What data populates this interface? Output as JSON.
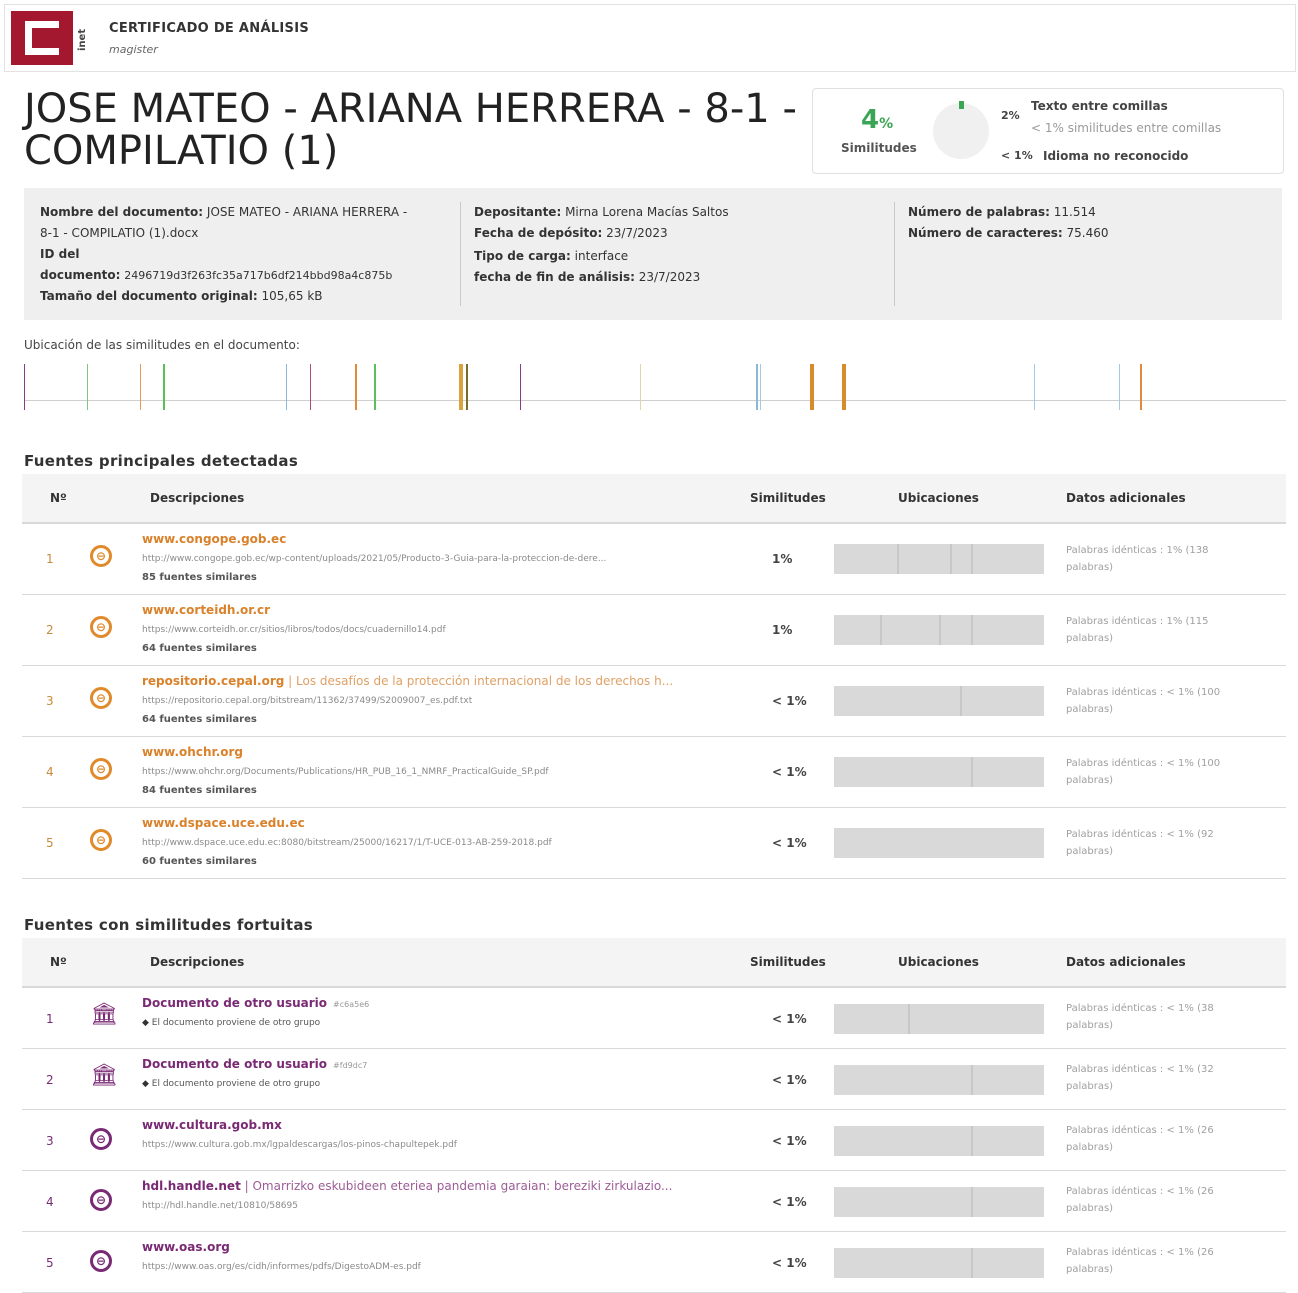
{
  "header": {
    "logo_side_text": "inet",
    "title": "CERTIFICADO DE ANÁLISIS",
    "subtitle": "magister"
  },
  "document_title": "JOSE MATEO - ARIANA HERRERA - 8-1 - COMPILATIO (1)",
  "summary": {
    "percent": "4",
    "percent_unit": "%",
    "label": "Similitudes",
    "lines": [
      {
        "value": "2%",
        "text": "Texto entre comillas"
      },
      {
        "value": "",
        "text": "< 1% similitudes entre comillas"
      },
      {
        "value": "< 1%",
        "text": "Idioma no reconocido"
      }
    ]
  },
  "info": {
    "col1": [
      {
        "label": "Nombre del documento:",
        "value": "JOSE MATEO - ARIANA HERRERA -"
      },
      {
        "label": "",
        "value": "8-1 - COMPILATIO (1).docx"
      },
      {
        "label": "ID del",
        "value": ""
      },
      {
        "label": "documento:",
        "value": "2496719d3f263fc35a717b6df214bbd98a4c875b"
      },
      {
        "label": "Tamaño del documento original:",
        "value": "105,65 kB"
      }
    ],
    "col2": [
      {
        "label": "Depositante:",
        "value": "Mirna Lorena Macías Saltos"
      },
      {
        "label": "Fecha de depósito:",
        "value": "23/7/2023"
      },
      {
        "label": "Tipo de carga:",
        "value": "interface"
      },
      {
        "label": "fecha de fin de análisis:",
        "value": "23/7/2023"
      }
    ],
    "col3": [
      {
        "label": "Número de palabras:",
        "value": "11.514"
      },
      {
        "label": "Número de caracteres:",
        "value": "75.460"
      }
    ]
  },
  "location_label": "Ubicación de las similitudes en el documento:",
  "location_ticks": [
    {
      "pos": 0.0,
      "color": "#8b3a8b",
      "w": 1
    },
    {
      "pos": 0.05,
      "color": "#7fc47f",
      "w": 1
    },
    {
      "pos": 0.092,
      "color": "#e39a5a",
      "w": 1
    },
    {
      "pos": 0.11,
      "color": "#5cbf5c",
      "w": 2
    },
    {
      "pos": 0.208,
      "color": "#8bb8d8",
      "w": 1
    },
    {
      "pos": 0.227,
      "color": "#b24a7a",
      "w": 1
    },
    {
      "pos": 0.262,
      "color": "#e08a3c",
      "w": 2
    },
    {
      "pos": 0.277,
      "color": "#5cbf5c",
      "w": 2
    },
    {
      "pos": 0.345,
      "color": "#d9a43c",
      "w": 4
    },
    {
      "pos": 0.35,
      "color": "#7b6a2a",
      "w": 2
    },
    {
      "pos": 0.393,
      "color": "#8b3a8b",
      "w": 1
    },
    {
      "pos": 0.488,
      "color": "#e5d2a8",
      "w": 1
    },
    {
      "pos": 0.58,
      "color": "#8bb8d8",
      "w": 2
    },
    {
      "pos": 0.583,
      "color": "#a8c8e0",
      "w": 1
    },
    {
      "pos": 0.623,
      "color": "#d98a2c",
      "w": 4
    },
    {
      "pos": 0.648,
      "color": "#d98a2c",
      "w": 4
    },
    {
      "pos": 0.8,
      "color": "#a8c8e0",
      "w": 1
    },
    {
      "pos": 0.868,
      "color": "#a8c8e0",
      "w": 1
    },
    {
      "pos": 0.884,
      "color": "#e08a3c",
      "w": 2
    }
  ],
  "main_sources": {
    "title": "Fuentes principales detectadas",
    "headers": {
      "num": "Nº",
      "desc": "Descripciones",
      "sim": "Similitudes",
      "loc": "Ubicaciones",
      "extra": "Datos adicionales"
    },
    "rows": [
      {
        "num": "1",
        "domain": "www.congope.gob.ec",
        "title": "",
        "url": "http://www.congope.gob.ec/wp-content/uploads/2021/05/Producto-3-Guia-para-la-proteccion-de-dere...",
        "count": "85 fuentes similares",
        "sim": "1%",
        "extra": "Palabras idénticas : 1% (138 palabras)",
        "marks": [
          0.3,
          0.55,
          0.65
        ]
      },
      {
        "num": "2",
        "domain": "www.corteidh.or.cr",
        "title": "",
        "url": "https://www.corteidh.or.cr/sitios/libros/todos/docs/cuadernillo14.pdf",
        "count": "64 fuentes similares",
        "sim": "1%",
        "extra": "Palabras idénticas : 1% (115 palabras)",
        "marks": [
          0.22,
          0.5,
          0.65
        ]
      },
      {
        "num": "3",
        "domain": "repositorio.cepal.org",
        "title": " | Los desafíos de la protección internacional de los derechos h...",
        "url": "https://repositorio.cepal.org/bitstream/11362/37499/S2009007_es.pdf.txt",
        "count": "64 fuentes similares",
        "sim": "< 1%",
        "extra": "Palabras idénticas : < 1% (100 palabras)",
        "marks": [
          0.6
        ]
      },
      {
        "num": "4",
        "domain": "www.ohchr.org",
        "title": "",
        "url": "https://www.ohchr.org/Documents/Publications/HR_PUB_16_1_NMRF_PracticalGuide_SP.pdf",
        "count": "84 fuentes similares",
        "sim": "< 1%",
        "extra": "Palabras idénticas : < 1% (100 palabras)",
        "marks": [
          0.65
        ]
      },
      {
        "num": "5",
        "domain": "www.dspace.uce.edu.ec",
        "title": "",
        "url": "http://www.dspace.uce.edu.ec:8080/bitstream/25000/16217/1/T-UCE-013-AB-259-2018.pdf",
        "count": "60 fuentes similares",
        "sim": "< 1%",
        "extra": "Palabras idénticas : < 1% (92 palabras)",
        "marks": []
      }
    ]
  },
  "fortuitous_sources": {
    "title": "Fuentes con similitudes fortuitas",
    "headers": {
      "num": "Nº",
      "desc": "Descripciones",
      "sim": "Similitudes",
      "loc": "Ubicaciones",
      "extra": "Datos adicionales"
    },
    "rows": [
      {
        "num": "1",
        "kind": "bank",
        "domain": "Documento de otro usuario",
        "tag": "#c6a5e6",
        "url": "El documento proviene de otro grupo",
        "sim": "< 1%",
        "extra": "Palabras idénticas : < 1% (38 palabras)",
        "marks": [
          0.35
        ]
      },
      {
        "num": "2",
        "kind": "bank",
        "domain": "Documento de otro usuario",
        "tag": "#fd9dc7",
        "url": "El documento proviene de otro grupo",
        "sim": "< 1%",
        "extra": "Palabras idénticas : < 1% (32 palabras)",
        "marks": [
          0.65
        ]
      },
      {
        "num": "3",
        "kind": "web",
        "domain": "www.cultura.gob.mx",
        "title": "",
        "url": "https://www.cultura.gob.mx/lgpaldescargas/los-pinos-chapultepek.pdf",
        "sim": "< 1%",
        "extra": "Palabras idénticas : < 1% (26 palabras)",
        "marks": [
          0.65
        ]
      },
      {
        "num": "4",
        "kind": "web",
        "domain": "hdl.handle.net",
        "title": " | Omarrizko eskubideen eteriea pandemia garaian: bereziki zirkulazio...",
        "url": "http://hdl.handle.net/10810/58695",
        "sim": "< 1%",
        "extra": "Palabras idénticas : < 1% (26 palabras)",
        "marks": [
          0.65
        ]
      },
      {
        "num": "5",
        "kind": "web",
        "domain": "www.oas.org",
        "title": "",
        "url": "https://www.oas.org/es/cidh/informes/pdfs/DigestoADM-es.pdf",
        "sim": "< 1%",
        "extra": "Palabras idénticas : < 1% (26 palabras)",
        "marks": [
          0.65
        ]
      }
    ]
  }
}
